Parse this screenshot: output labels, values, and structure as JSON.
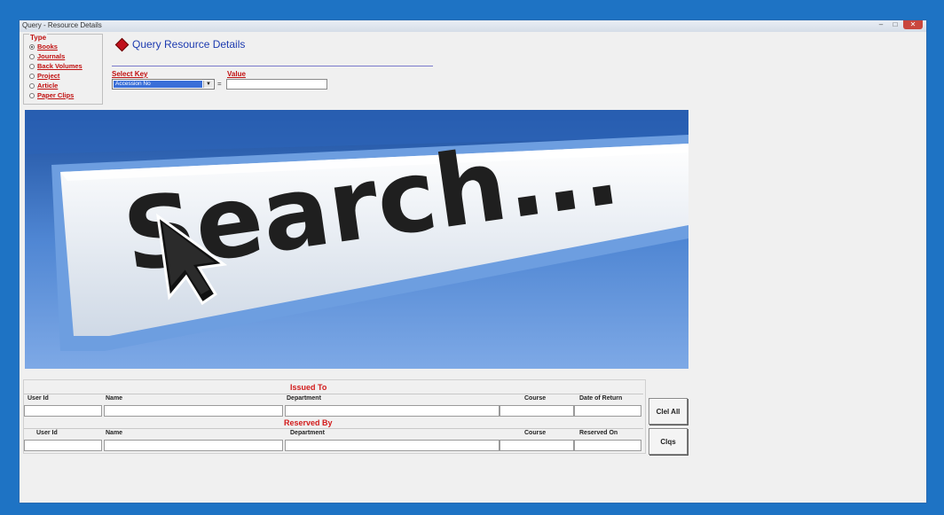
{
  "window": {
    "title": "Query - Resource Details"
  },
  "type_group": {
    "legend": "Type",
    "options": [
      {
        "label": "Books",
        "checked": true
      },
      {
        "label": "Journals",
        "checked": false
      },
      {
        "label": "Back Volumes",
        "checked": false
      },
      {
        "label": "Project",
        "checked": false
      },
      {
        "label": "Article",
        "checked": false
      },
      {
        "label": "Paper Clips",
        "checked": false
      }
    ]
  },
  "heading": "Query Resource  Details",
  "search": {
    "select_key_label": "Select Key",
    "value_label": "Value",
    "selected_key": "Accession No",
    "equals": "=",
    "value": ""
  },
  "banner": {
    "text": "Search..."
  },
  "issued_to": {
    "title": "Issued To",
    "columns": [
      "User Id",
      "Name",
      "Department",
      "Course",
      "Date of Return"
    ]
  },
  "reserved_by": {
    "title": "Reserved By",
    "columns": [
      "User Id",
      "Name",
      "Department",
      "Course",
      "Reserved On"
    ]
  },
  "buttons": {
    "clear_all": "Clel All",
    "close": "Clqs"
  },
  "colors": {
    "accent": "#c01010",
    "heading": "#1d3bb0",
    "frame": "#1e73c4"
  }
}
